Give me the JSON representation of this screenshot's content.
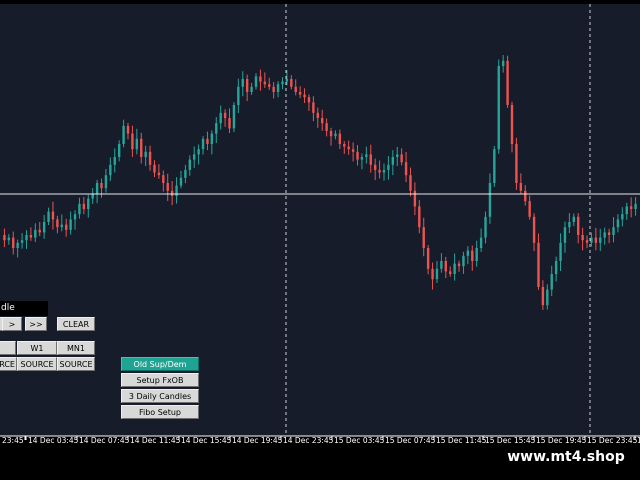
{
  "colors": {
    "background": "#161c2a",
    "bull": "#26a69a",
    "bear": "#ef5350",
    "grid": "#ffffff"
  },
  "panel": {
    "label_partial": "dle",
    "row1": [
      "<",
      ">",
      ">>",
      "CLEAR"
    ],
    "row2": [
      "",
      "W1",
      "MN1"
    ],
    "row3": [
      "RCE",
      "SOURCE",
      "SOURCE"
    ]
  },
  "menu": {
    "items": [
      "Old Sup/Dem",
      "Setup FxOB",
      "3 Daily Candles",
      "Fibo Setup"
    ],
    "active_index": 0
  },
  "time_axis": {
    "labels": [
      "23:45",
      "14 Dec 03:45",
      "14 Dec 07:45",
      "14 Dec 11:45",
      "14 Dec 15:45",
      "14 Dec 19:45",
      "14 Dec 23:45",
      "15 Dec 03:45",
      "15 Dec 07:45",
      "15 Dec 11:45",
      "15 Dec 15:45",
      "15 Dec 19:45",
      "15 Dec 23:45",
      "1"
    ]
  },
  "watermark": "www.mt4.shop",
  "chart_data": {
    "type": "candlestick",
    "title": "",
    "xlabel": "",
    "ylabel": "",
    "horizontal_line_level": 0.38,
    "vertical_separators": [
      "14 Dec 23:45",
      "15 Dec 23:45"
    ],
    "price_path": [
      0.25,
      0.23,
      0.24,
      0.2,
      0.22,
      0.23,
      0.25,
      0.24,
      0.27,
      0.26,
      0.3,
      0.34,
      0.31,
      0.28,
      0.29,
      0.27,
      0.31,
      0.33,
      0.37,
      0.35,
      0.39,
      0.41,
      0.45,
      0.43,
      0.48,
      0.52,
      0.55,
      0.6,
      0.67,
      0.64,
      0.58,
      0.62,
      0.55,
      0.57,
      0.52,
      0.49,
      0.48,
      0.45,
      0.42,
      0.4,
      0.44,
      0.47,
      0.5,
      0.54,
      0.56,
      0.58,
      0.62,
      0.6,
      0.64,
      0.68,
      0.72,
      0.7,
      0.66,
      0.75,
      0.82,
      0.85,
      0.8,
      0.82,
      0.86,
      0.84,
      0.83,
      0.82,
      0.8,
      0.83,
      0.84,
      0.85,
      0.82,
      0.8,
      0.79,
      0.78,
      0.76,
      0.72,
      0.7,
      0.68,
      0.65,
      0.63,
      0.64,
      0.6,
      0.59,
      0.58,
      0.57,
      0.54,
      0.55,
      0.56,
      0.52,
      0.5,
      0.49,
      0.5,
      0.52,
      0.55,
      0.56,
      0.53,
      0.48,
      0.42,
      0.36,
      0.28,
      0.2,
      0.12,
      0.08,
      0.12,
      0.15,
      0.11,
      0.1,
      0.14,
      0.13,
      0.17,
      0.19,
      0.15,
      0.2,
      0.24,
      0.32,
      0.45,
      0.58,
      0.9,
      0.92,
      0.75,
      0.6,
      0.45,
      0.42,
      0.38,
      0.32,
      0.22,
      0.05,
      -0.02,
      0.04,
      0.1,
      0.15,
      0.22,
      0.28,
      0.3,
      0.32,
      0.25,
      0.23,
      0.22,
      0.24,
      0.22,
      0.24,
      0.26,
      0.25,
      0.28,
      0.31,
      0.33,
      0.36,
      0.35,
      0.37
    ]
  }
}
